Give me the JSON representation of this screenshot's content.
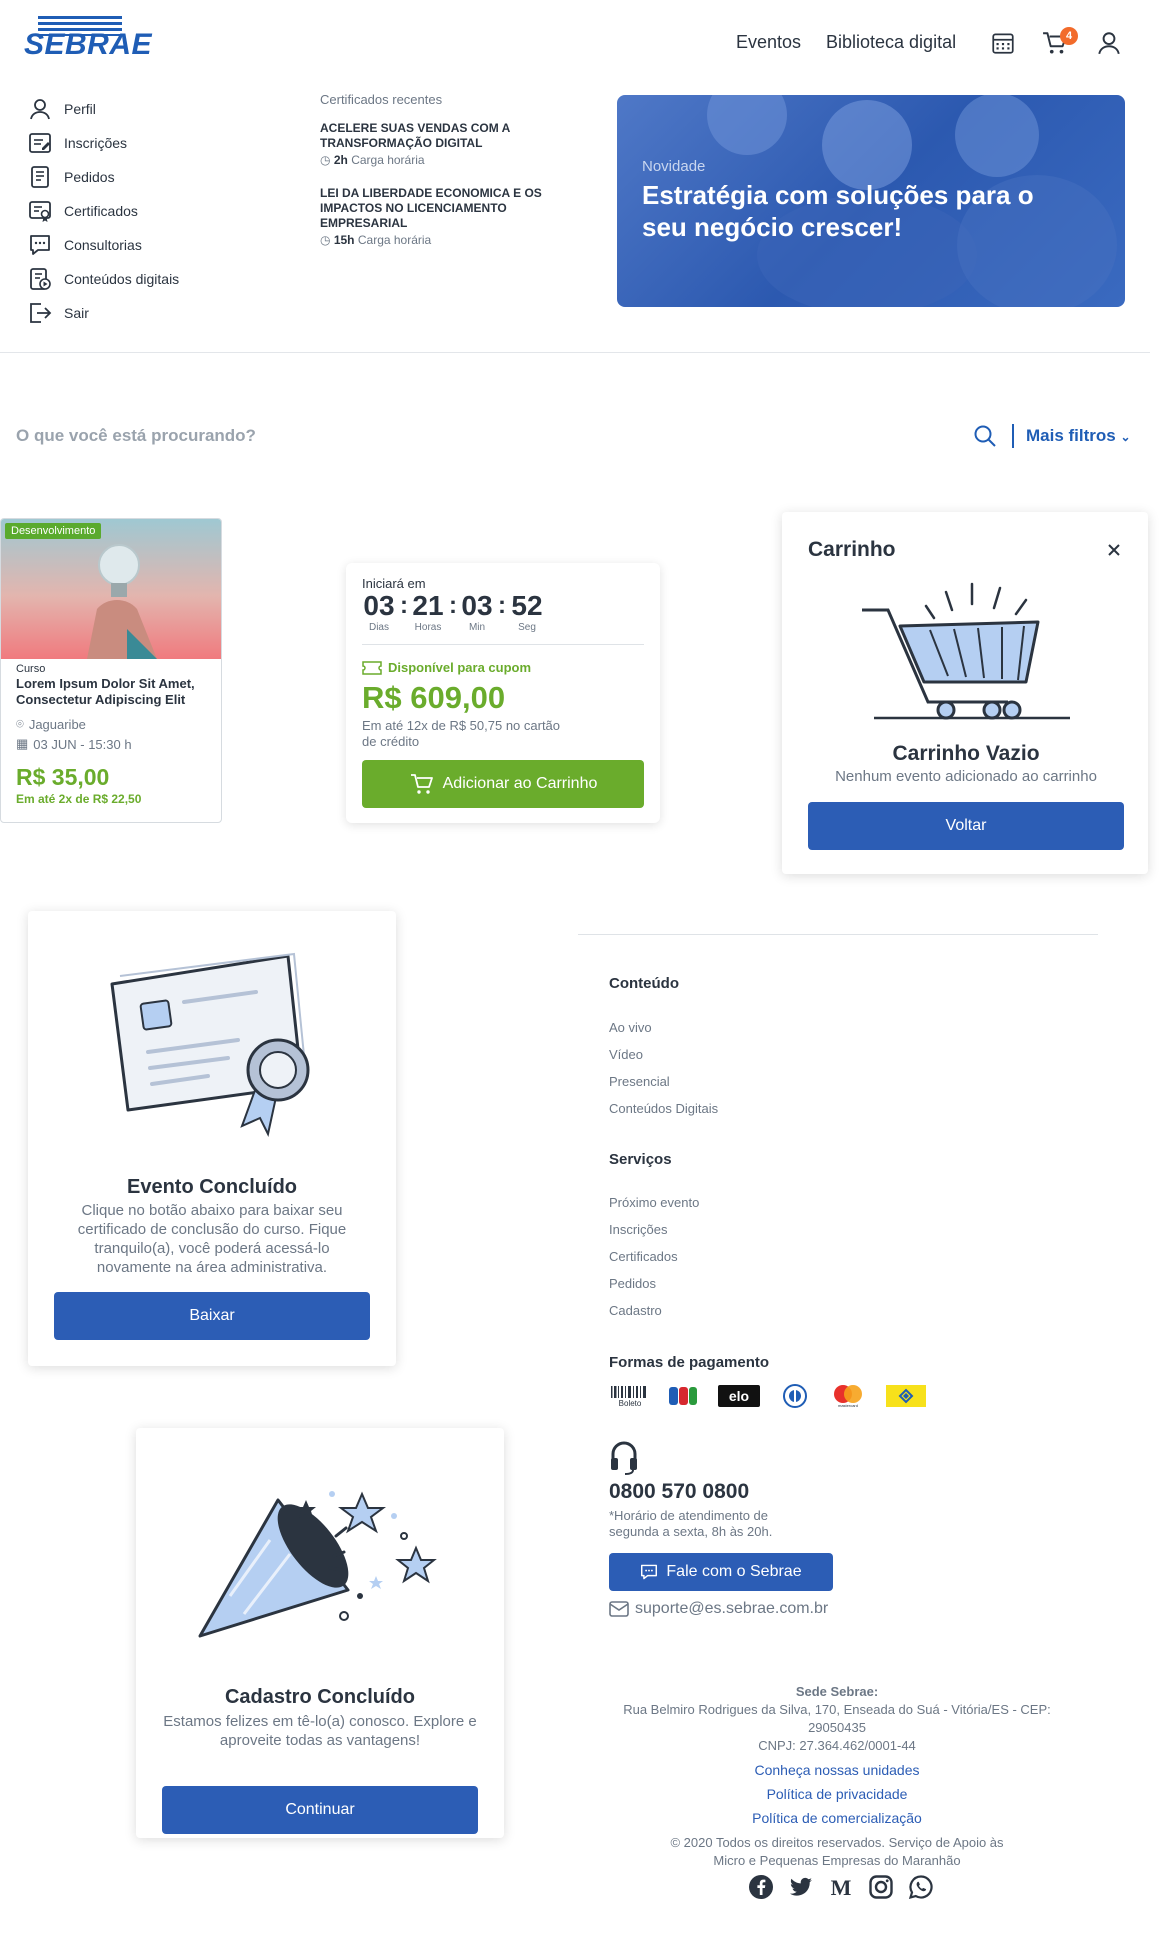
{
  "header": {
    "logo_text": "SEBRAE",
    "nav": [
      "Eventos",
      "Biblioteca digital"
    ],
    "cart_count": "4"
  },
  "menu": [
    "Perfil",
    "Inscrições",
    "Pedidos",
    "Certificados",
    "Consultorias",
    "Conteúdos digitais",
    "Sair"
  ],
  "recent": {
    "heading": "Certificados recentes",
    "items": [
      {
        "title": "ACELERE SUAS VENDAS COM A TRANSFORMAÇÃO DIGITAL",
        "hours": "2h",
        "hours_label": "Carga horária"
      },
      {
        "title": "LEI DA LIBERDADE ECONOMICA E OS IMPACTOS NO LICENCIAMENTO EMPRESARIAL",
        "hours": "15h",
        "hours_label": "Carga horária"
      }
    ]
  },
  "hero": {
    "tag": "Novidade",
    "title": "Estratégia com soluções para o seu negócio crescer!"
  },
  "search": {
    "placeholder": "O que você está procurando?",
    "filters": "Mais filtros"
  },
  "course": {
    "badge": "Desenvolvimento",
    "label": "Curso",
    "title": "Lorem Ipsum Dolor Sit Amet, Consectetur Adipiscing Elit",
    "location": "Jaguaribe",
    "date": "03 JUN - 15:30 h",
    "price": "R$ 35,00",
    "installments": "Em até 2x de  R$ 22,50"
  },
  "countdown": {
    "label": "Iniciará em",
    "units": [
      {
        "value": "03",
        "label": "Dias"
      },
      {
        "value": "21",
        "label": "Horas"
      },
      {
        "value": "03",
        "label": "Min"
      },
      {
        "value": "52",
        "label": "Seg"
      }
    ],
    "coupon": "Disponível para cupom",
    "price": "R$ 609,00",
    "installments": "Em até 12x de R$ 50,75 no cartão de crédito",
    "add_button": "Adicionar ao Carrinho"
  },
  "cart": {
    "title": "Carrinho",
    "empty_title": "Carrinho Vazio",
    "empty_text": "Nenhum evento adicionado ao carrinho",
    "button": "Voltar"
  },
  "event_done": {
    "title": "Evento Concluído",
    "text": "Clique no botão abaixo para baixar seu certificado de conclusão do curso. Fique tranquilo(a), você poderá acessá-lo novamente na área administrativa.",
    "button": "Baixar"
  },
  "register_done": {
    "title": "Cadastro Concluído",
    "text": "Estamos felizes em tê-lo(a) conosco. Explore e aproveite todas as vantagens!",
    "button": "Continuar"
  },
  "footer": {
    "content_heading": "Conteúdo",
    "content_links": [
      "Ao vivo",
      "Vídeo",
      "Presencial",
      "Conteúdos Digitais"
    ],
    "services_heading": "Serviços",
    "services_links": [
      "Próximo evento",
      "Inscrições",
      "Certificados",
      "Pedidos",
      "Cadastro"
    ],
    "payment_heading": "Formas de pagamento",
    "payment_methods": [
      "Boleto",
      "JCB",
      "elo",
      "Diners",
      "mastercard",
      "Banco do Brasil"
    ],
    "phone": "0800 570 0800",
    "hours": "*Horário de atendimento de segunda a sexta, 8h às 20h.",
    "chat_button": "Fale com o Sebrae",
    "email": "suporte@es.sebrae.com.br",
    "hq_label": "Sede Sebrae:",
    "address": "Rua Belmiro Rodrigues da Silva, 170, Enseada do Suá - Vitória/ES - CEP: 29050435",
    "cnpj": "CNPJ: 27.364.462/0001-44",
    "links": [
      "Conheça nossas unidades",
      "Política de privacidade",
      "Política de comercialização"
    ],
    "copyright": "© 2020 Todos os direitos reservados. Serviço de Apoio às Micro e Pequenas Empresas do Maranhão",
    "social": [
      "facebook",
      "twitter",
      "medium",
      "instagram",
      "whatsapp"
    ]
  }
}
